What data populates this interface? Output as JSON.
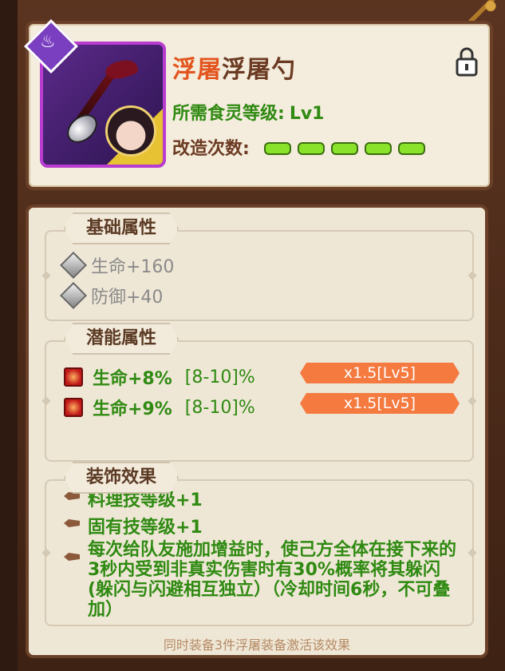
{
  "header": {
    "title_prefix": "浮屠",
    "title_name": "浮屠勺",
    "level_label": "所需食灵等级:",
    "level_value": "Lv1",
    "refine_label": "改造次数:",
    "refine_count": 5,
    "badge_icon": "bowl-icon",
    "lock_icon": "lock-icon"
  },
  "base": {
    "tab": "基础属性",
    "stats": [
      {
        "label": "生命+160"
      },
      {
        "label": "防御+40"
      }
    ]
  },
  "potential": {
    "tab": "潜能属性",
    "stats": [
      {
        "label": "生命+8%",
        "range": "[8-10]%",
        "bonus": "x1.5[Lv5]"
      },
      {
        "label": "生命+9%",
        "range": "[8-10]%",
        "bonus": "x1.5[Lv5]"
      }
    ]
  },
  "decoration": {
    "tab": "装饰效果",
    "partial_line": "料理技等级+1",
    "line1": "固有技等级+1",
    "line2": "每次给队友施加增益时，使己方全体在接下来的3秒内受到非真实伤害时有30%概率将其躲闪(躲闪与闪避相互独立）（冷却时间6秒，不可叠加）",
    "note": "同时装备3件浮屠装备激活该效果"
  },
  "colors": {
    "accent_orange": "#e2551e",
    "green_text": "#2f8a12",
    "bonus_bar": "#f47a40",
    "frame_brown": "#6b4028"
  }
}
